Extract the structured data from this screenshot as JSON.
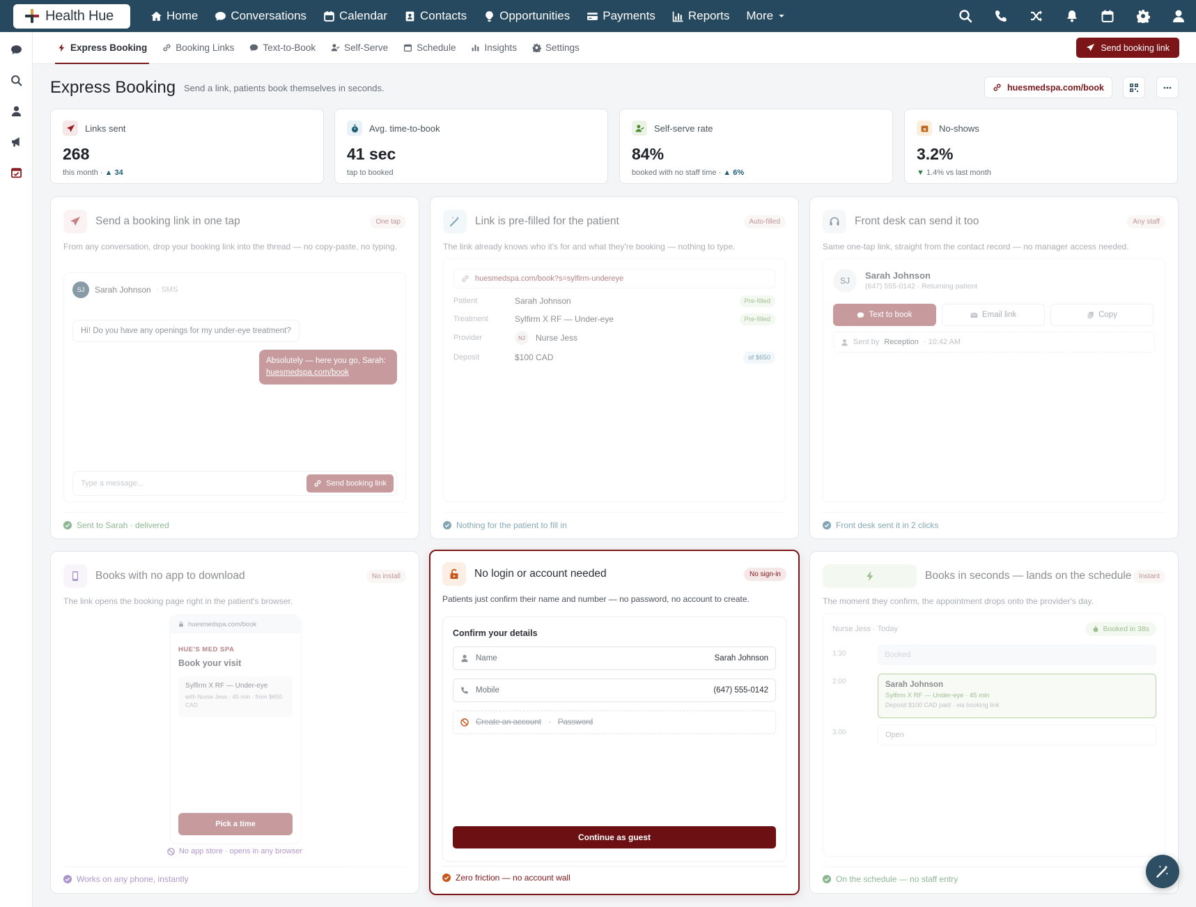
{
  "brand": {
    "name": "Health Hue",
    "accent": "#7c1518",
    "nav_bg": "#26495f"
  },
  "nav": {
    "items": [
      {
        "label": "Home",
        "icon": "home-icon"
      },
      {
        "label": "Conversations",
        "icon": "chat-icon"
      },
      {
        "label": "Calendar",
        "icon": "calendar-icon"
      },
      {
        "label": "Contacts",
        "icon": "contacts-icon"
      },
      {
        "label": "Opportunities",
        "icon": "lightbulb-icon"
      },
      {
        "label": "Payments",
        "icon": "credit-card-icon"
      },
      {
        "label": "Reports",
        "icon": "bar-chart-icon"
      },
      {
        "label": "More",
        "icon": "chevron-down-icon"
      }
    ],
    "right_icons": [
      "search-icon",
      "phone-icon",
      "shuffle-icon",
      "bell-icon",
      "calendar-icon",
      "gear-icon",
      "user-icon"
    ]
  },
  "rail": {
    "icons": [
      "chat-icon",
      "search-icon",
      "user-icon",
      "megaphone-icon",
      "calendar-check-icon"
    ]
  },
  "subnav": {
    "tabs": [
      {
        "label": "Express Booking",
        "icon": "bolt-icon",
        "active": true
      },
      {
        "label": "Booking Links",
        "icon": "link-icon"
      },
      {
        "label": "Text-to-Book",
        "icon": "chat-icon"
      },
      {
        "label": "Self-Serve",
        "icon": "user-check-icon"
      },
      {
        "label": "Schedule",
        "icon": "calendar-icon"
      },
      {
        "label": "Insights",
        "icon": "bar-chart-icon"
      },
      {
        "label": "Settings",
        "icon": "gear-icon"
      }
    ],
    "cta": "Send booking link"
  },
  "header": {
    "title": "Express Booking",
    "subtitle": "Send a link, patients book themselves in seconds.",
    "url": "huesmedspa.com/book"
  },
  "stats": [
    {
      "label": "Links sent",
      "value": "268",
      "sub": "this month · ",
      "delta": "▲ 34",
      "icon": "paper-plane-icon"
    },
    {
      "label": "Avg. time-to-book",
      "value": "41 sec",
      "sub": "tap to booked",
      "delta": "",
      "icon": "stopwatch-icon"
    },
    {
      "label": "Self-serve rate",
      "value": "84%",
      "sub": "booked with no staff time · ",
      "delta": "▲ 6%",
      "icon": "user-check-icon"
    },
    {
      "label": "No-shows",
      "value": "3.2%",
      "sub": " 1.4% vs last month",
      "delta": "▼",
      "icon": "calendar-x-icon"
    }
  ],
  "cards": {
    "tap": {
      "title": "Send a booking link in one tap",
      "badge": "One tap",
      "desc": "From any conversation, drop your booking link into the thread — no copy-paste, no typing.",
      "contact_initials": "SJ",
      "contact_name": "Sarah Johnson",
      "channel": "· SMS",
      "msg_in": "Hi! Do you have any openings for my under-eye treatment?",
      "msg_out": "Absolutely — here you go, Sarah:",
      "msg_link": "huesmedspa.com/book",
      "composer_placeholder": "Type a message...",
      "send_label": "Send booking link",
      "footer": "Sent to Sarah · delivered"
    },
    "prefill": {
      "title": "Link is pre-filled for the patient",
      "badge": "Auto-filled",
      "desc": "The link already knows who it's for and what they're booking — nothing to type.",
      "url": "huesmedspa.com/book?s=sylfirm-undereye",
      "rows": [
        {
          "label": "Patient",
          "value": "Sarah Johnson",
          "tag": "Pre-filled"
        },
        {
          "label": "Treatment",
          "value": "Sylfirm X RF — Under-eye",
          "tag": "Pre-filled"
        },
        {
          "label": "Provider",
          "value": "Nurse Jess",
          "initials": "NJ",
          "tag": ""
        },
        {
          "label": "Deposit",
          "value": "$100 CAD",
          "tag": "of $650"
        }
      ],
      "footer": "Nothing for the patient to fill in"
    },
    "frontdesk": {
      "title": "Front desk can send it too",
      "badge": "Any staff",
      "desc": "Same one-tap link, straight from the contact record — no manager access needed.",
      "initials": "SJ",
      "name": "Sarah Johnson",
      "meta": "(647) 555-0142 · Returning patient",
      "buttons": [
        "Text to book",
        "Email link",
        "Copy"
      ],
      "sent_by": "Sent by",
      "sender": "Reception",
      "time": "· 10:42 AM",
      "footer": "Front desk sent it in 2 clicks"
    },
    "noapp": {
      "title": "Books with no app to download",
      "badge": "No install",
      "desc": "The link opens the booking page right in the patient's browser.",
      "url": "huesmedspa.com/book",
      "spa": "HUE'S MED SPA",
      "heading": "Book your visit",
      "service": "Sylfirm X RF — Under-eye",
      "service_meta": "with Nurse Jess · 45 min · from $650 CAD",
      "pick": "Pick a time",
      "note": "No app store · opens in any browser",
      "footer": "Works on any phone, instantly"
    },
    "nologin": {
      "title": "No login or account needed",
      "badge": "No sign-in",
      "desc": "Patients just confirm their name and number — no password, no account to create.",
      "form_title": "Confirm your details",
      "name_label": "Name",
      "name_value": "Sarah Johnson",
      "mobile_label": "Mobile",
      "mobile_value": "(647) 555-0142",
      "create": "Create an account",
      "sep": "·",
      "password": "Password",
      "cta": "Continue as guest",
      "footer": "Zero friction — no account wall"
    },
    "schedule": {
      "title": "Books in seconds — lands on the schedule",
      "badge": "Instant",
      "desc": "The moment they confirm, the appointment drops onto the provider's day.",
      "header": "Nurse Jess · Today",
      "booked_badge": "Booked in 38s",
      "slots": [
        {
          "time": "1:30",
          "label": "Booked"
        },
        {
          "time": "2:00",
          "name": "Sarah Johnson",
          "detail": "Sylfirm X RF — Under-eye · 45 min",
          "deposit": "Deposit $100 CAD paid · via booking link"
        },
        {
          "time": "3:00",
          "label": "Open"
        }
      ],
      "footer": "On the schedule — no staff entry"
    }
  }
}
